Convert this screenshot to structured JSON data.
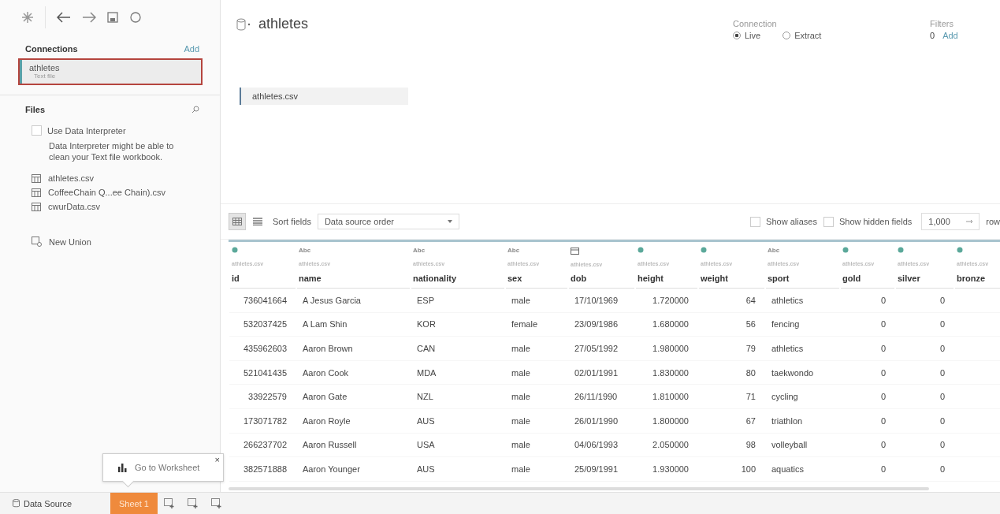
{
  "sidebar": {
    "connections_heading": "Connections",
    "add_link": "Add",
    "connections": [
      {
        "name": "athletes",
        "type": "Text file",
        "selected": true
      }
    ],
    "files_heading": "Files",
    "interpreter": {
      "label": "Use Data Interpreter",
      "checked": false,
      "note": "Data Interpreter might be able to clean your Text file workbook."
    },
    "files": [
      "athletes.csv",
      "CoffeeChain Q...ee Chain).csv",
      "cwurData.csv"
    ],
    "new_union": "New Union"
  },
  "header": {
    "title": "athletes",
    "connection_label": "Connection",
    "connection_modes": [
      {
        "label": "Live",
        "selected": true
      },
      {
        "label": "Extract",
        "selected": false
      }
    ],
    "filters_label": "Filters",
    "filters_count": "0",
    "filters_add": "Add"
  },
  "canvas": {
    "tables": [
      "athletes.csv"
    ]
  },
  "grid_toolbar": {
    "views": [
      {
        "kind": "grid",
        "selected": true
      },
      {
        "kind": "list",
        "selected": false
      }
    ],
    "sort_label": "Sort fields",
    "sort_value": "Data source order",
    "options": [
      {
        "label": "Show aliases",
        "checked": false
      },
      {
        "label": "Show hidden fields",
        "checked": false
      }
    ],
    "row_count": "1,000",
    "rows_label": "row"
  },
  "table": {
    "columns": [
      {
        "name": "id",
        "source": "athletes.csv",
        "kind": "number"
      },
      {
        "name": "name",
        "source": "athletes.csv",
        "kind": "string",
        "type_text": "Abc"
      },
      {
        "name": "nationality",
        "source": "athletes.csv",
        "kind": "string",
        "type_text": "Abc"
      },
      {
        "name": "sex",
        "source": "athletes.csv",
        "kind": "string",
        "type_text": "Abc"
      },
      {
        "name": "dob",
        "source": "athletes.csv",
        "kind": "date"
      },
      {
        "name": "height",
        "source": "athletes.csv",
        "kind": "number"
      },
      {
        "name": "weight",
        "source": "athletes.csv",
        "kind": "number"
      },
      {
        "name": "sport",
        "source": "athletes.csv",
        "kind": "string",
        "type_text": "Abc"
      },
      {
        "name": "gold",
        "source": "athletes.csv",
        "kind": "number"
      },
      {
        "name": "silver",
        "source": "athletes.csv",
        "kind": "number"
      },
      {
        "name": "bronze",
        "source": "athletes.csv",
        "kind": "number"
      }
    ],
    "rows": [
      [
        "736041664",
        "A Jesus Garcia",
        "ESP",
        "male",
        "17/10/1969",
        "1.720000",
        "64",
        "athletics",
        "0",
        "0"
      ],
      [
        "532037425",
        "A Lam Shin",
        "KOR",
        "female",
        "23/09/1986",
        "1.680000",
        "56",
        "fencing",
        "0",
        "0"
      ],
      [
        "435962603",
        "Aaron Brown",
        "CAN",
        "male",
        "27/05/1992",
        "1.980000",
        "79",
        "athletics",
        "0",
        "0"
      ],
      [
        "521041435",
        "Aaron Cook",
        "MDA",
        "male",
        "02/01/1991",
        "1.830000",
        "80",
        "taekwondo",
        "0",
        "0"
      ],
      [
        "33922579",
        "Aaron Gate",
        "NZL",
        "male",
        "26/11/1990",
        "1.810000",
        "71",
        "cycling",
        "0",
        "0"
      ],
      [
        "173071782",
        "Aaron Royle",
        "AUS",
        "male",
        "26/01/1990",
        "1.800000",
        "67",
        "triathlon",
        "0",
        "0"
      ],
      [
        "266237702",
        "Aaron Russell",
        "USA",
        "male",
        "04/06/1993",
        "2.050000",
        "98",
        "volleyball",
        "0",
        "0"
      ],
      [
        "382571888",
        "Aaron Younger",
        "AUS",
        "male",
        "25/09/1991",
        "1.930000",
        "100",
        "aquatics",
        "0",
        "0"
      ]
    ]
  },
  "tooltip": {
    "text": "Go to Worksheet",
    "close": "×"
  },
  "tabs": {
    "data_source": "Data Source",
    "sheets": [
      {
        "label": "Sheet 1",
        "selected": true
      }
    ]
  }
}
